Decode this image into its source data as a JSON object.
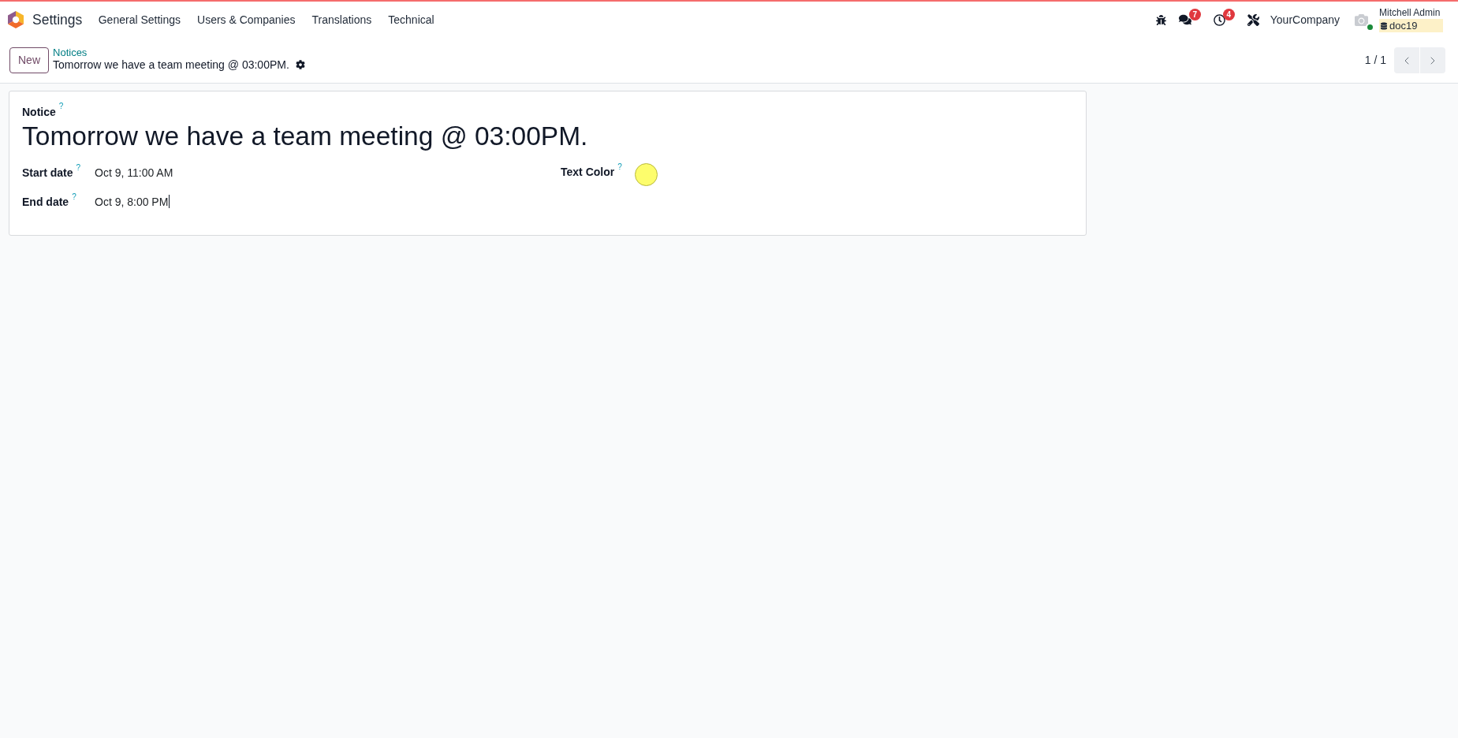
{
  "navbar": {
    "app_name": "Settings",
    "menu": [
      "General Settings",
      "Users & Companies",
      "Translations",
      "Technical"
    ],
    "systray": [
      {
        "kind": "debug"
      },
      {
        "kind": "messages",
        "badge": "7"
      },
      {
        "kind": "activities",
        "badge": "4"
      },
      {
        "kind": "tools"
      }
    ],
    "company": "YourCompany",
    "user": {
      "name": "Mitchell Admin",
      "database": "doc19",
      "online": true
    }
  },
  "control_panel": {
    "new_button": "New",
    "breadcrumb": "Notices",
    "record_title": "Tomorrow we have a team meeting @ 03:00PM.",
    "pager": "1 / 1"
  },
  "form": {
    "notice": {
      "label": "Notice",
      "help": "?",
      "value": "Tomorrow we have a team meeting @ 03:00PM."
    },
    "date_fields": [
      {
        "label": "Start date",
        "help": "?",
        "value": "Oct 9, 11:00 AM",
        "focused": false
      },
      {
        "label": "End date",
        "help": "?",
        "value": "Oct 9, 8:00 PM",
        "focused": true
      }
    ],
    "text_color": {
      "label": "Text Color",
      "help": "?",
      "color": "#fdfd6c"
    }
  }
}
